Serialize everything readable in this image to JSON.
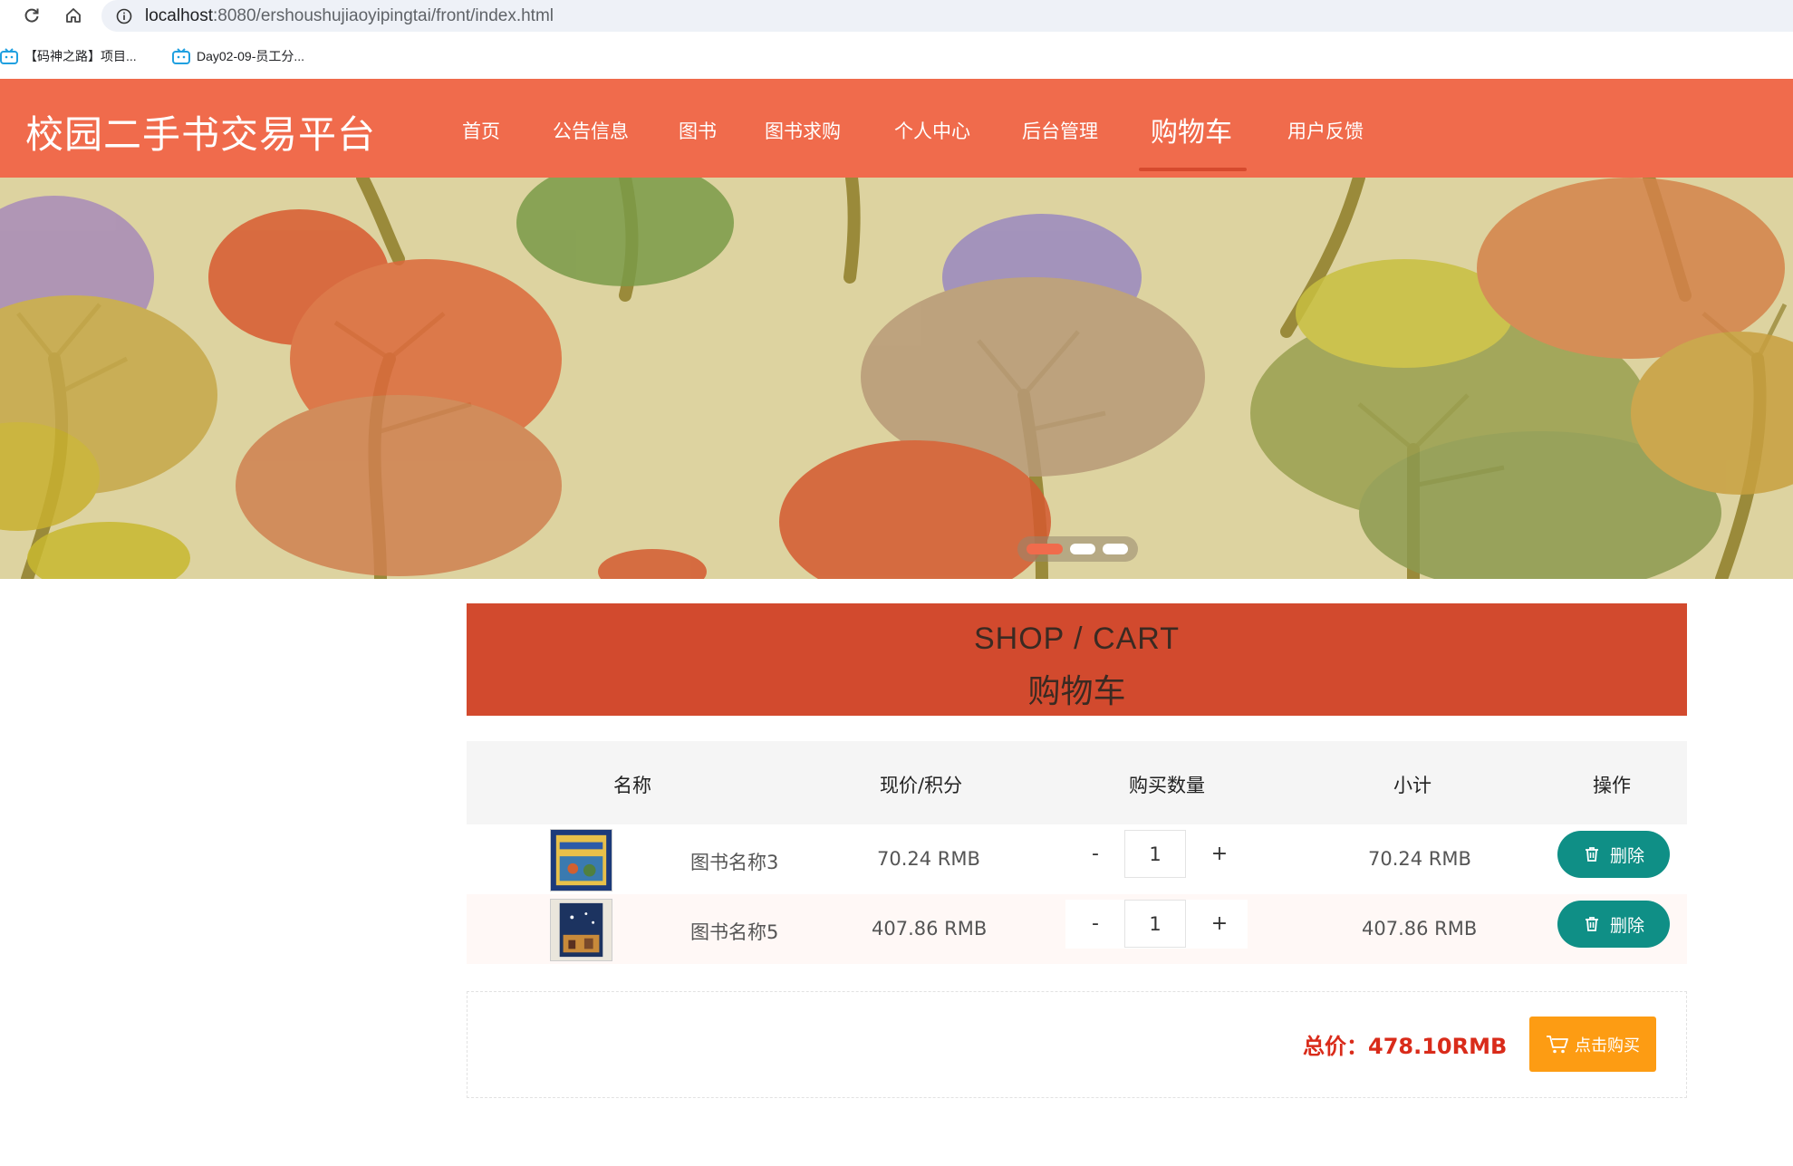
{
  "browser": {
    "url_host": "localhost",
    "url_rest": ":8080/ershoushujiaoyipingtai/front/index.html",
    "bookmarks": [
      {
        "label": "【码神之路】项目...",
        "icon": "bilibili-tv-icon"
      },
      {
        "label": "Day02-09-员工分...",
        "icon": "bilibili-tv-icon"
      }
    ]
  },
  "header": {
    "title": "校园二手书交易平台",
    "nav": [
      {
        "label": "首页"
      },
      {
        "label": "公告信息"
      },
      {
        "label": "图书"
      },
      {
        "label": "图书求购"
      },
      {
        "label": "个人中心"
      },
      {
        "label": "后台管理"
      },
      {
        "label": "购物车",
        "active": true
      },
      {
        "label": "用户反馈"
      }
    ]
  },
  "banner": {
    "slides": 3,
    "active_slide": 1
  },
  "section": {
    "title_en": "SHOP / CART",
    "title_cn": "购物车"
  },
  "cart": {
    "columns": [
      "名称",
      "现价/积分",
      "购买数量",
      "小计",
      "操作"
    ],
    "rows": [
      {
        "name": "图书名称3",
        "price": "70.24 RMB",
        "qty": "1",
        "subtotal": "70.24 RMB",
        "delete_label": "删除",
        "minus": "-",
        "plus": "+"
      },
      {
        "name": "图书名称5",
        "price": "407.86 RMB",
        "qty": "1",
        "subtotal": "407.86 RMB",
        "delete_label": "删除",
        "minus": "-",
        "plus": "+"
      }
    ],
    "total_label": "总价：478.10RMB",
    "buy_label": "点击购买"
  },
  "colors": {
    "header": "#f06b4c",
    "section": "#d24a2e",
    "delete_button": "#0f8f86",
    "buy_button": "#fd9c13",
    "total_text": "#d92b1a"
  }
}
